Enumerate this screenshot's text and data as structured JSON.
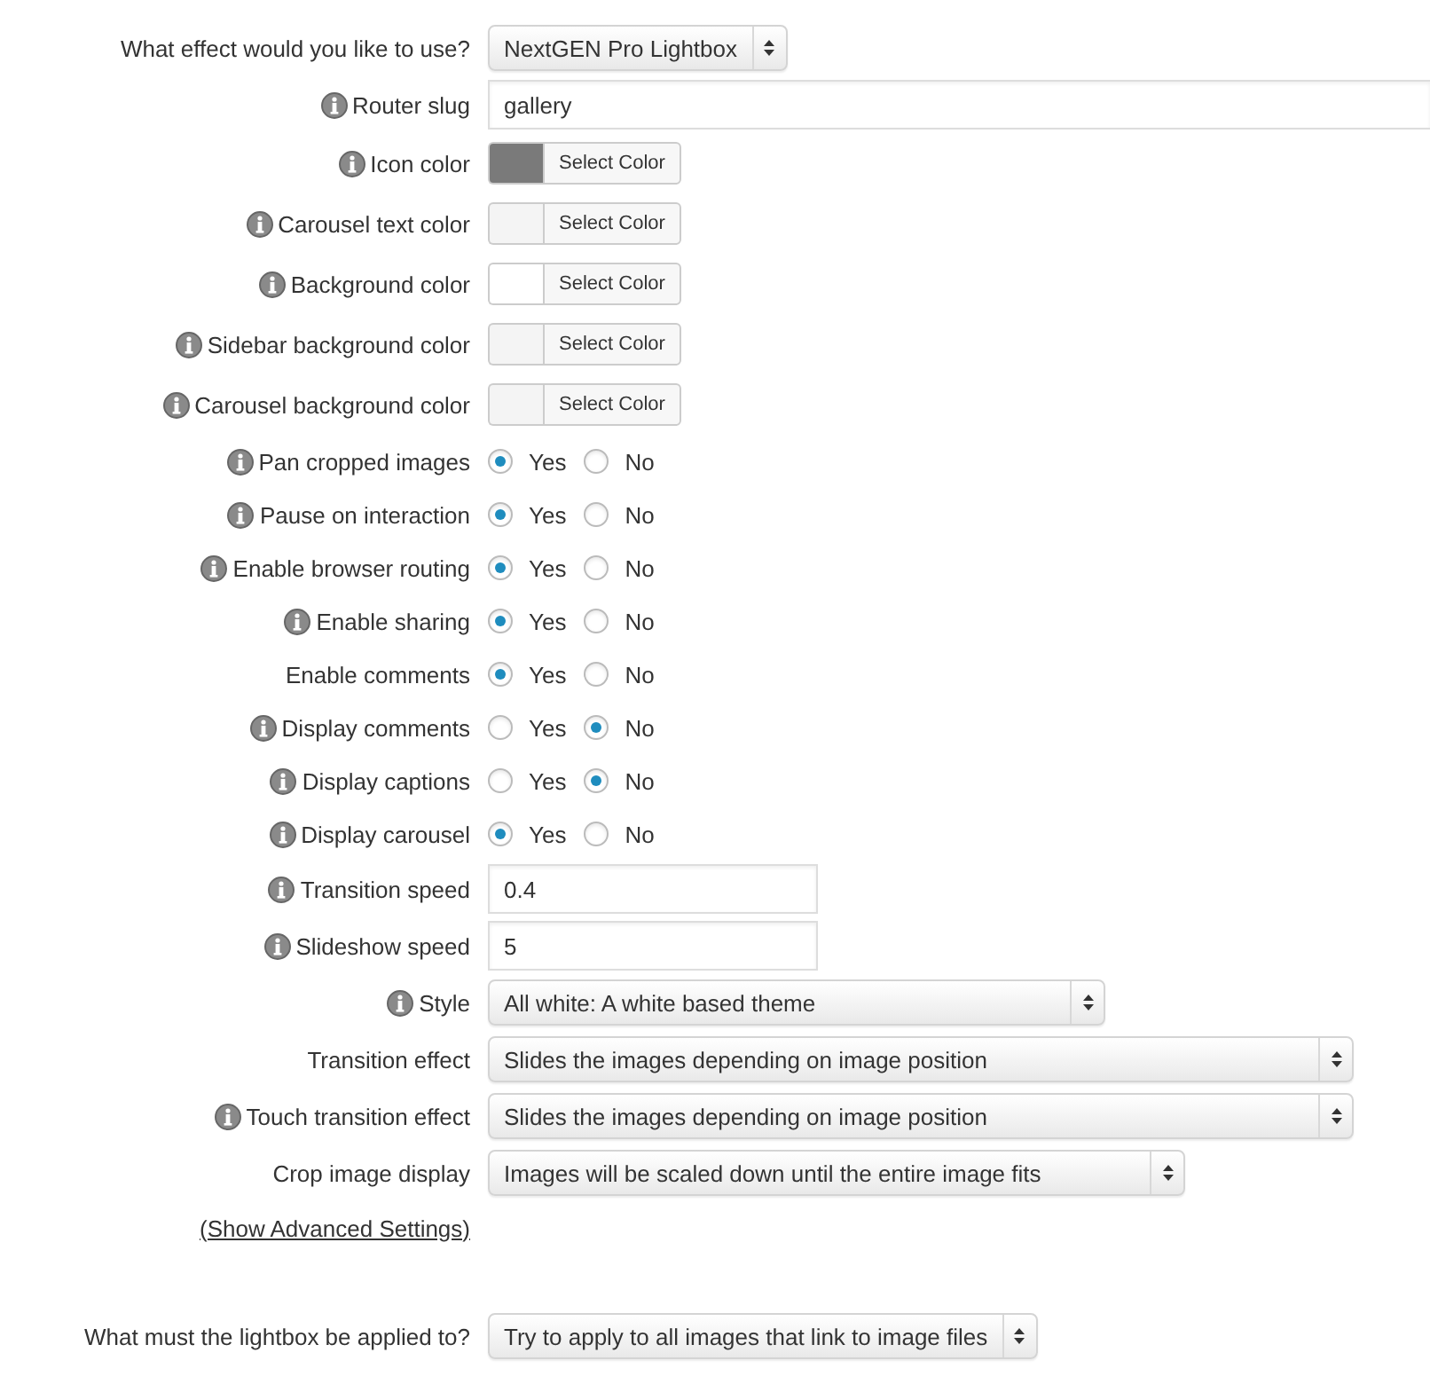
{
  "settings": [
    {
      "kind": "select",
      "label": "What effect would you like to use?",
      "info": false,
      "value": "NextGEN Pro Lightbox"
    },
    {
      "kind": "text",
      "label": "Router slug",
      "info": true,
      "value": "gallery"
    },
    {
      "kind": "color",
      "label": "Icon color",
      "info": true,
      "color": "#7a7a7a",
      "button": "Select Color"
    },
    {
      "kind": "color",
      "label": "Carousel text color",
      "info": true,
      "color": "#f4f4f4",
      "button": "Select Color"
    },
    {
      "kind": "color",
      "label": "Background color",
      "info": true,
      "color": "#ffffff",
      "button": "Select Color"
    },
    {
      "kind": "color",
      "label": "Sidebar background color",
      "info": true,
      "color": "#f4f4f4",
      "button": "Select Color"
    },
    {
      "kind": "color",
      "label": "Carousel background color",
      "info": true,
      "color": "#f4f4f4",
      "button": "Select Color"
    },
    {
      "kind": "radio",
      "label": "Pan cropped images",
      "info": true,
      "options": [
        {
          "label": "Yes",
          "selected": true
        },
        {
          "label": "No",
          "selected": false
        }
      ]
    },
    {
      "kind": "radio",
      "label": "Pause on interaction",
      "info": true,
      "options": [
        {
          "label": "Yes",
          "selected": true
        },
        {
          "label": "No",
          "selected": false
        }
      ]
    },
    {
      "kind": "radio",
      "label": "Enable browser routing",
      "info": true,
      "options": [
        {
          "label": "Yes",
          "selected": true
        },
        {
          "label": "No",
          "selected": false
        }
      ]
    },
    {
      "kind": "radio",
      "label": "Enable sharing",
      "info": true,
      "options": [
        {
          "label": "Yes",
          "selected": true
        },
        {
          "label": "No",
          "selected": false
        }
      ]
    },
    {
      "kind": "radio",
      "label": "Enable comments",
      "info": false,
      "options": [
        {
          "label": "Yes",
          "selected": true
        },
        {
          "label": "No",
          "selected": false
        }
      ]
    },
    {
      "kind": "radio",
      "label": "Display comments",
      "info": true,
      "options": [
        {
          "label": "Yes",
          "selected": false
        },
        {
          "label": "No",
          "selected": true
        }
      ]
    },
    {
      "kind": "radio",
      "label": "Display captions",
      "info": true,
      "options": [
        {
          "label": "Yes",
          "selected": false
        },
        {
          "label": "No",
          "selected": true
        }
      ]
    },
    {
      "kind": "radio",
      "label": "Display carousel",
      "info": true,
      "options": [
        {
          "label": "Yes",
          "selected": true
        },
        {
          "label": "No",
          "selected": false
        }
      ]
    },
    {
      "kind": "text",
      "label": "Transition speed",
      "info": true,
      "value": "0.4"
    },
    {
      "kind": "text",
      "label": "Slideshow speed",
      "info": true,
      "value": "5"
    },
    {
      "kind": "select",
      "label": "Style",
      "info": true,
      "value": "All white: A white based theme"
    },
    {
      "kind": "select",
      "label": "Transition effect",
      "info": false,
      "value": "Slides the images depending on image position"
    },
    {
      "kind": "select",
      "label": "Touch transition effect",
      "info": true,
      "value": "Slides the images depending on image position"
    },
    {
      "kind": "select",
      "label": "Crop image display",
      "info": false,
      "value": "Images will be scaled down until the entire image fits"
    },
    {
      "kind": "link",
      "label": "(Show Advanced Settings)"
    }
  ],
  "apply": {
    "kind": "select",
    "label": "What must the lightbox be applied to?",
    "info": false,
    "value": "Try to apply to all images that link to image files"
  }
}
